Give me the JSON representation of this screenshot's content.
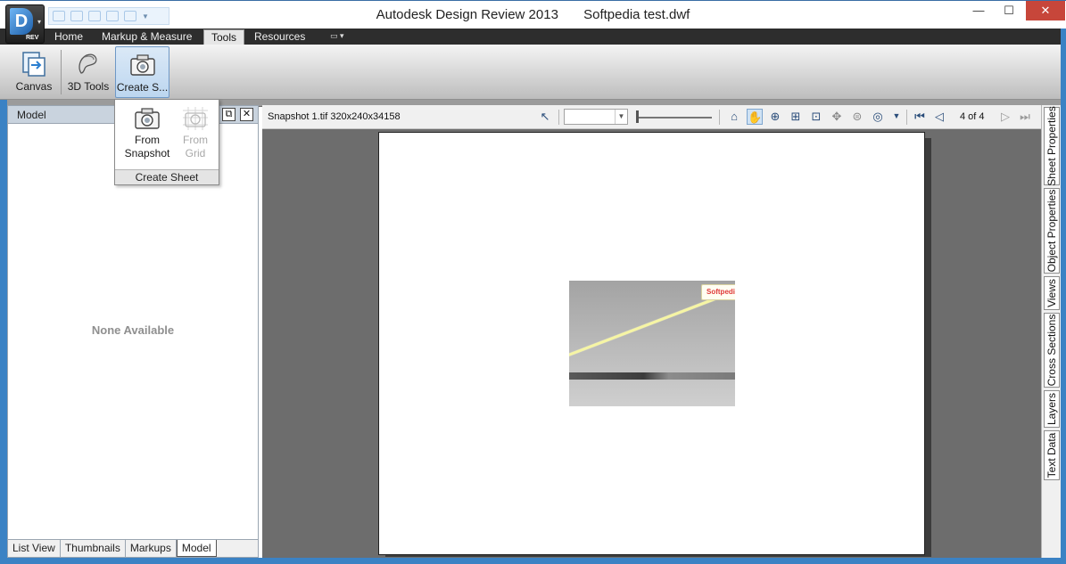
{
  "window": {
    "app_title": "Autodesk Design Review 2013",
    "document_title": "Softpedia test.dwf",
    "app_button_badge": "REV",
    "app_button_letter": "D",
    "minimize": "—",
    "maximize": "☐",
    "close": "✕"
  },
  "ribbon_tabs": {
    "home": "Home",
    "markup": "Markup & Measure",
    "tools": "Tools",
    "resources": "Resources",
    "extra": "▭ ▾"
  },
  "ribbon": {
    "canvas": "Canvas",
    "tools3d": "3D Tools",
    "create_sheet": "Create S..."
  },
  "dropdown": {
    "from_snapshot_line1": "From",
    "from_snapshot_line2": "Snapshot",
    "from_grid_line1": "From",
    "from_grid_line2": "Grid",
    "footer": "Create Sheet"
  },
  "left_panel": {
    "title": "Model",
    "empty_text": "None Available",
    "tabs": [
      "List View",
      "Thumbnails",
      "Markups",
      "Model"
    ],
    "active_tab": "Model"
  },
  "view_toolbar": {
    "file_info": "Snapshot 1.tif 320x240x34158",
    "page_indicator": "4 of 4",
    "icons": [
      "select-arrow-icon",
      "home-icon",
      "pan-hand-icon",
      "zoom-icon",
      "zoom-rectangle-icon",
      "fit-window-icon",
      "orbit-icon",
      "turntable-icon",
      "steering-wheel-icon",
      "first-page-icon",
      "previous-page-icon",
      "next-page-icon",
      "last-page-icon"
    ]
  },
  "snapshot": {
    "tag_text": "Softpedia"
  },
  "right_tabs": [
    "Sheet Properties",
    "Object Properties",
    "Views",
    "Cross Sections",
    "Layers",
    "Text Data"
  ],
  "colors": {
    "window_frame": "#3b82c4",
    "canvas_bg": "#6d6d6d",
    "close_button": "#c7463a"
  }
}
